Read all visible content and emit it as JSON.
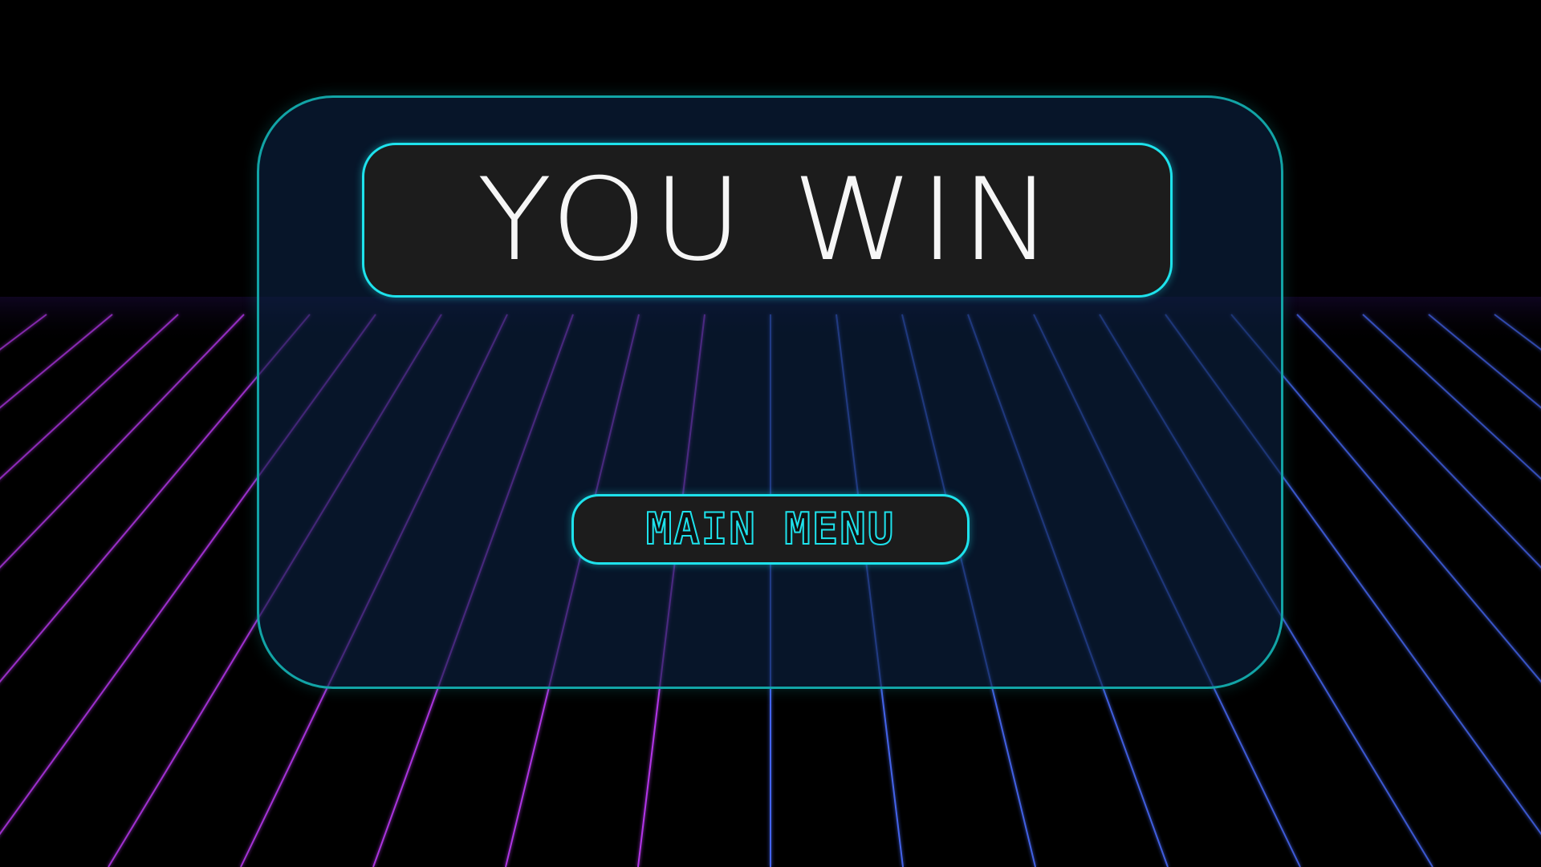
{
  "screen": "win",
  "colors": {
    "background": "#000000",
    "panel_border": "#12a4a6",
    "accent_cyan": "#1ee2ec",
    "box_fill": "#1c1c1c",
    "title_text": "#f6f6f6",
    "grid_purple": "#c43cff",
    "grid_blue": "#4a6cff"
  },
  "title": {
    "text": "YOU WIN"
  },
  "main_menu_button": {
    "label": "MAIN MENU"
  }
}
